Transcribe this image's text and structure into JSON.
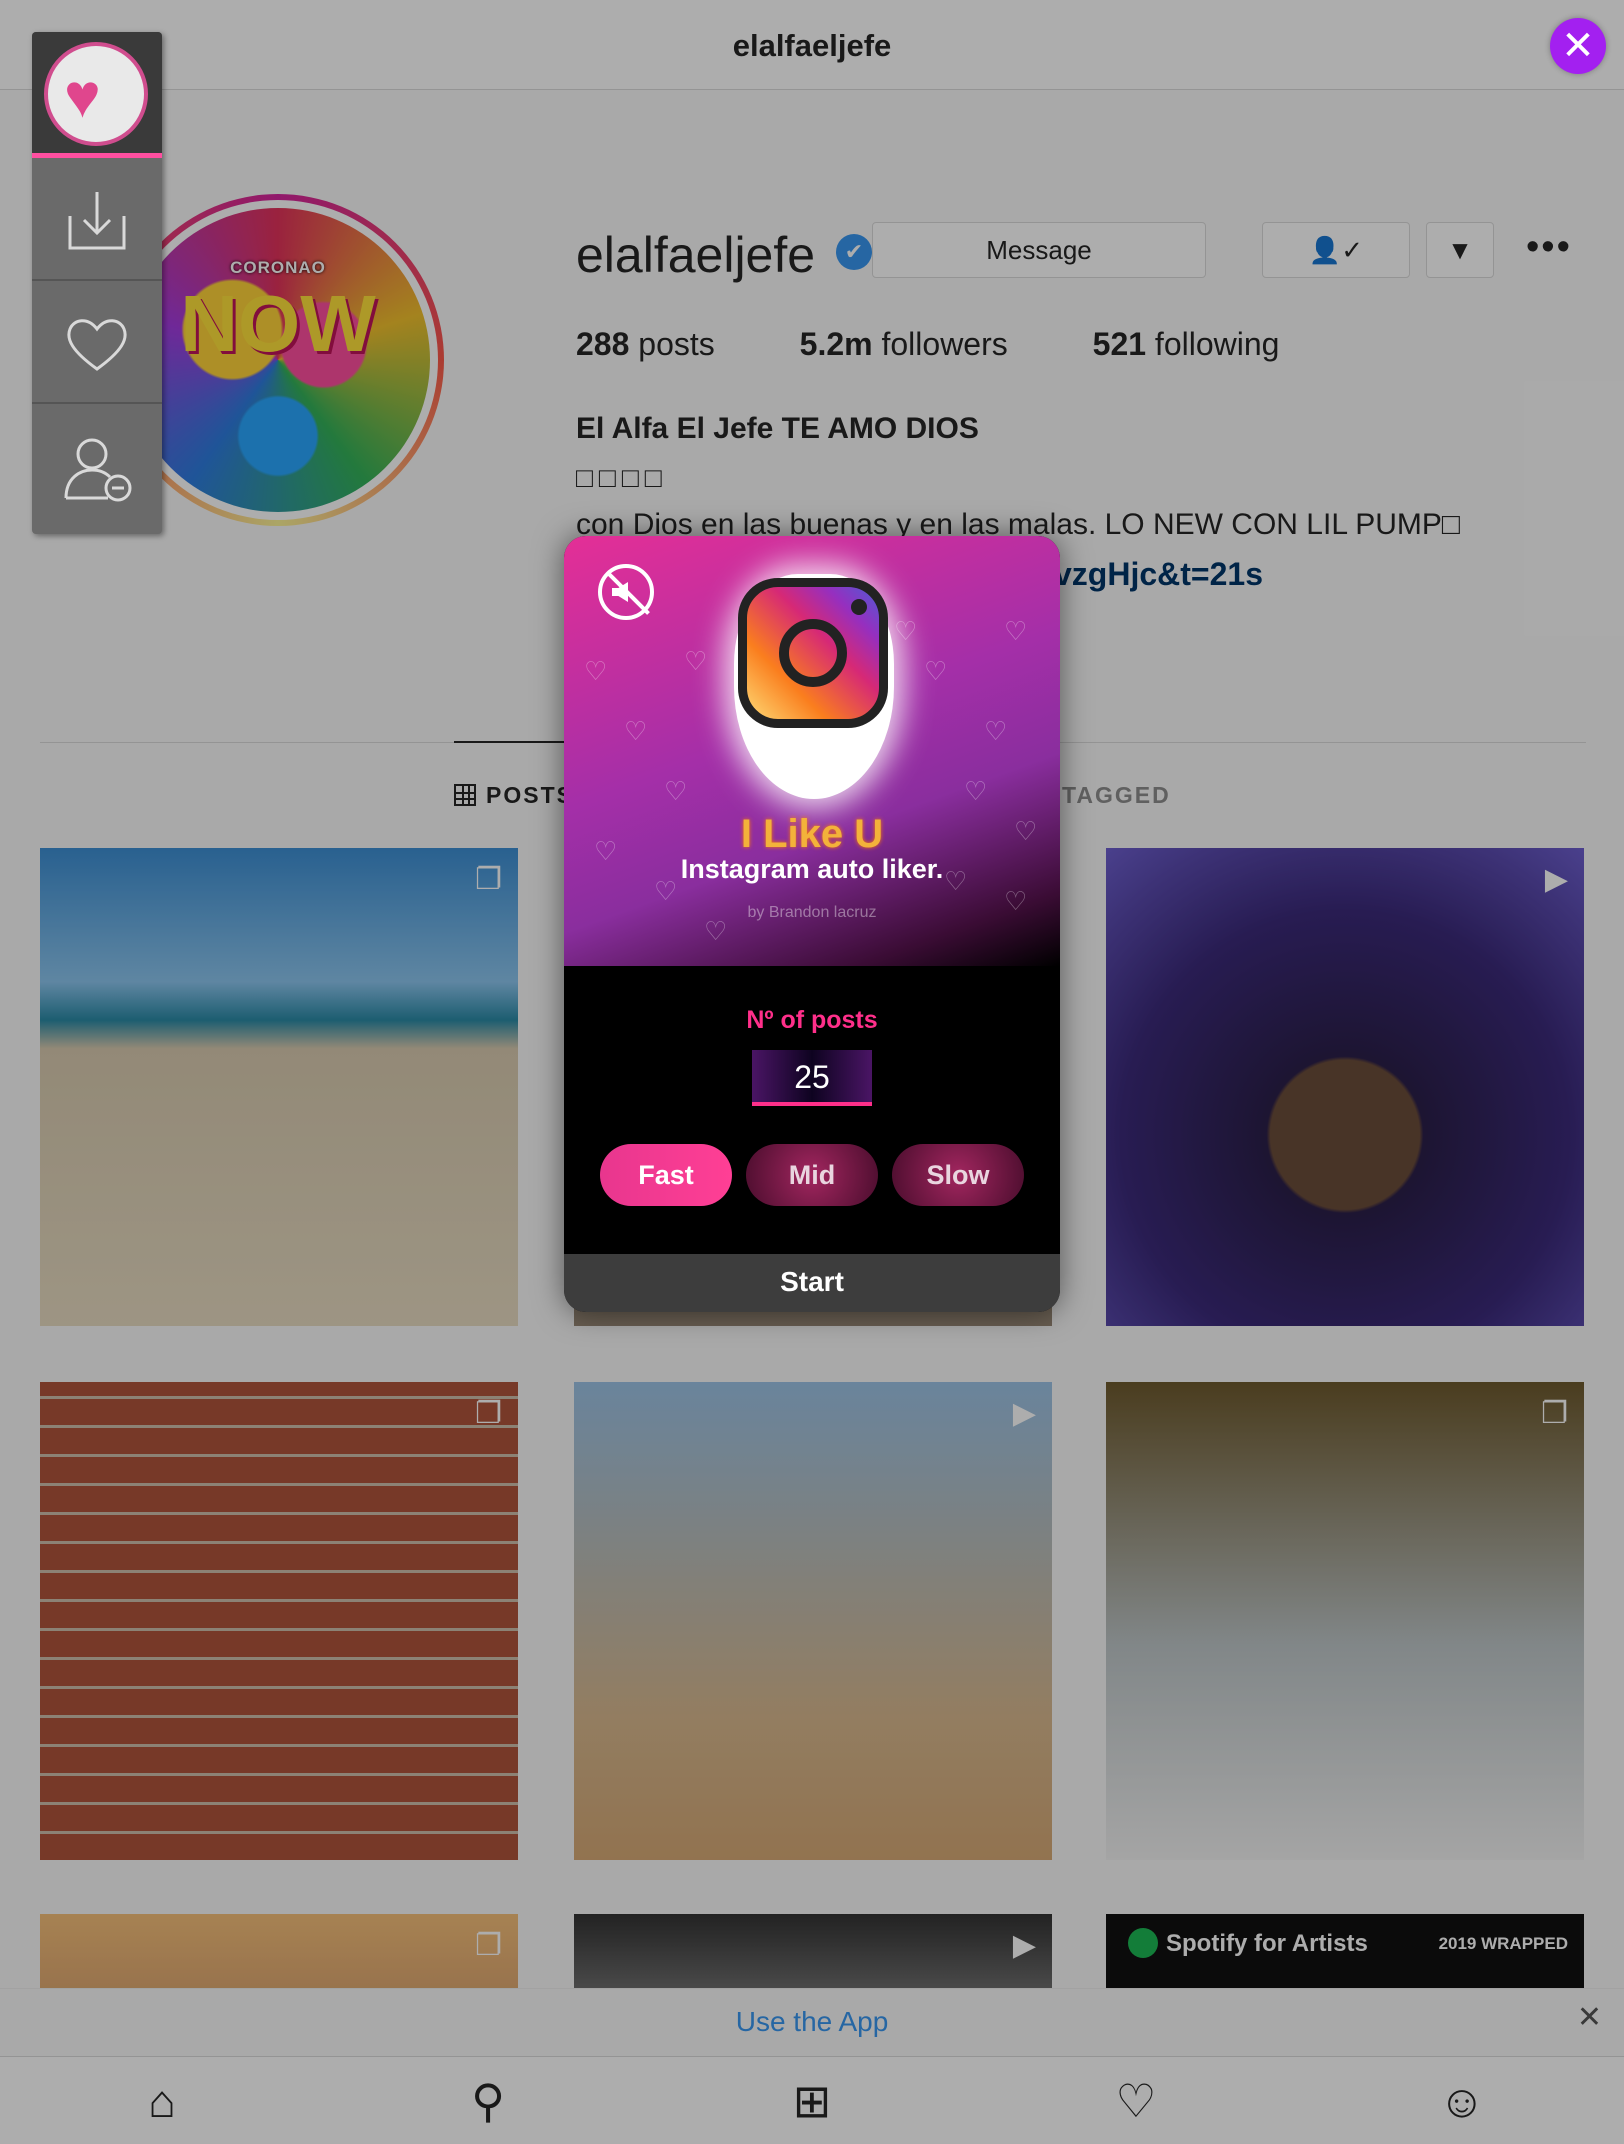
{
  "header": {
    "title": "elalfaeljefe",
    "back_icon": "chevron-left-icon"
  },
  "profile": {
    "avatar_tag": "CORONAO",
    "avatar_big": "NOW",
    "username": "elalfaeljefe",
    "verified_glyph": "✔",
    "message_label": "Message",
    "follow_glyph": "👤✓",
    "dropdown_glyph": "▼",
    "more_glyph": "•••",
    "posts_count": "288",
    "posts_label": "posts",
    "followers_count": "5.2m",
    "followers_label": "followers",
    "following_count": "521",
    "following_label": "following",
    "bio_name": "El Alfa El Jefe TE AMO DIOS",
    "bio_boxes": "□□□□",
    "bio_line": "con Dios en las buenas y en las malas. LO NEW CON LIL PUMP□",
    "bio_link_tail": "vzgHjc&t=21s"
  },
  "tabs": {
    "posts": "POSTS",
    "tagged": "TAGGED"
  },
  "posts": {
    "badge_multi": "❐",
    "badge_video": "▶",
    "spotify_label": "Spotify for Artists",
    "spotify_wrapped": "2019 WRAPPED"
  },
  "use_app": {
    "label": "Use the App",
    "close": "✕"
  },
  "bottom_nav": {
    "home": "⌂",
    "search": "⚲",
    "new_post": "⊞",
    "activity": "♡",
    "profile": "☺"
  },
  "extension": {
    "close": "✕",
    "app_name": "I Like U",
    "tagline": "Instagram auto liker.",
    "author": "by Brandon lacruz",
    "posts_label": "Nº of posts",
    "posts_value": "25",
    "speed_options": [
      "Fast",
      "Mid",
      "Slow"
    ],
    "selected_speed": "Fast",
    "start_label": "Start"
  },
  "colors": {
    "accent": "#ff2f8a",
    "close_button": "#a320f0",
    "link": "#003569",
    "use_app": "#3897f0"
  }
}
